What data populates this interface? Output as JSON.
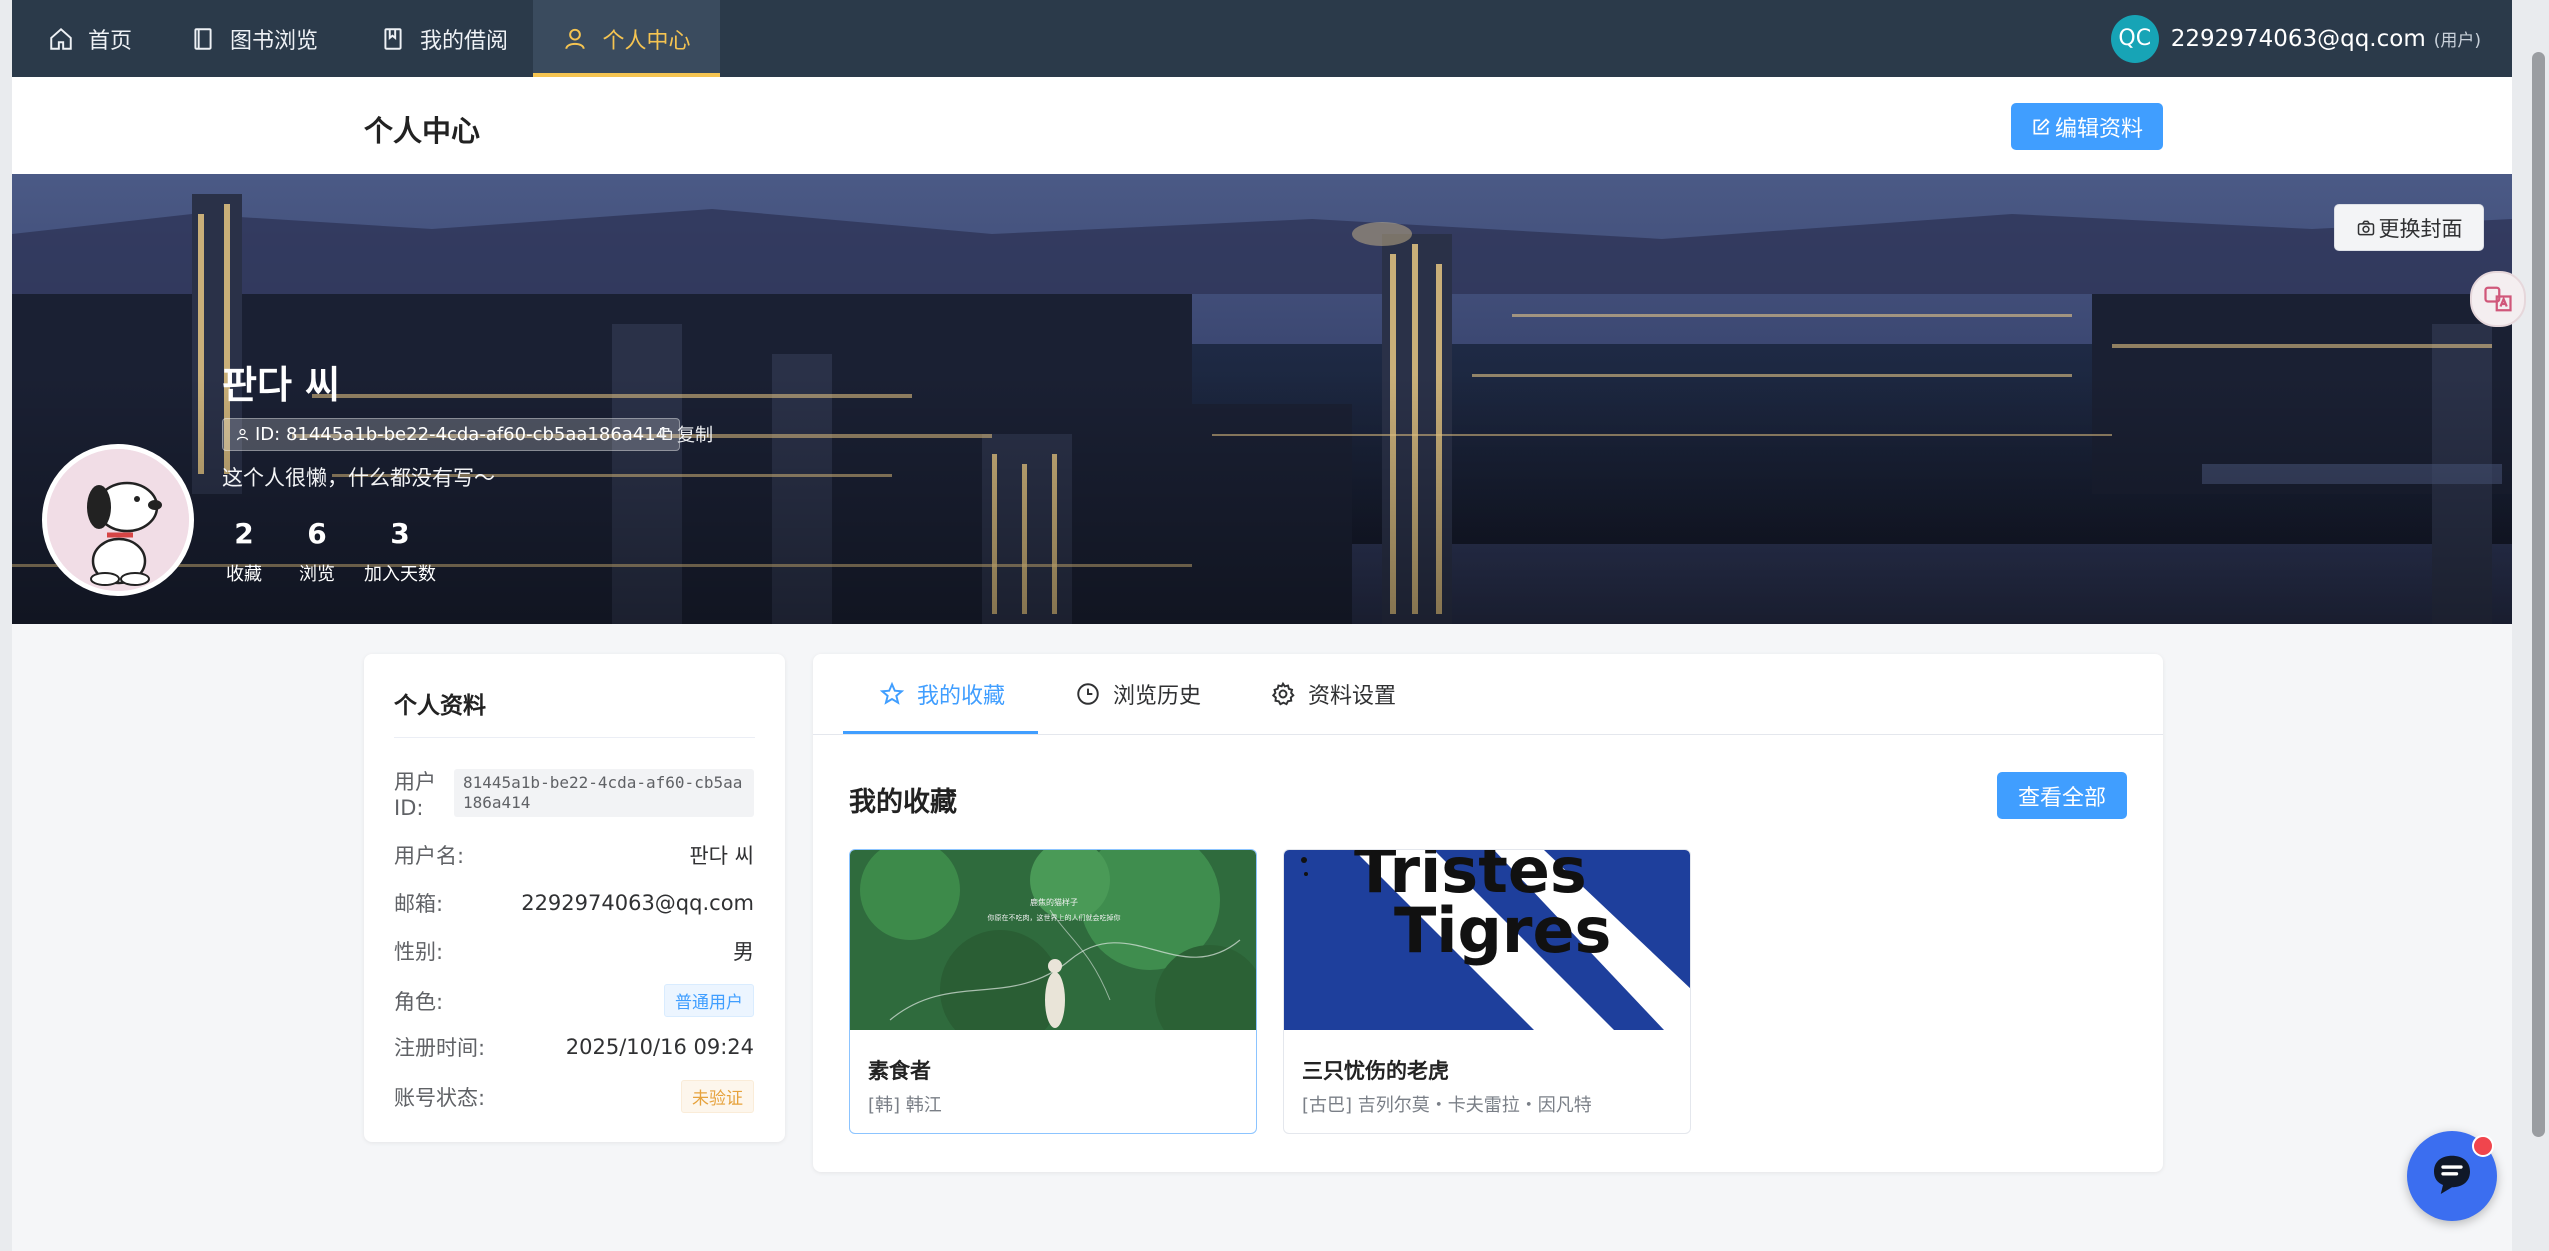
{
  "nav": {
    "items": [
      {
        "label": "首页",
        "icon": "home-icon"
      },
      {
        "label": "图书浏览",
        "icon": "book-icon"
      },
      {
        "label": "我的借阅",
        "icon": "bookmark-icon"
      },
      {
        "label": "个人中心",
        "icon": "user-icon",
        "active": true
      }
    ],
    "user": {
      "initials": "QC",
      "email": "2292974063@qq.com",
      "role": "(用户)"
    }
  },
  "header": {
    "title": "个人中心",
    "edit_button": "编辑资料"
  },
  "cover": {
    "change_cover_button": "更换封面",
    "name": "판다 씨",
    "id_chip": "ID: 81445a1b-be22-4cda-af60-cb5aa186a414",
    "copy_label": "复制",
    "bio": "这个人很懒，什么都没有写～",
    "stats": [
      {
        "value": "2",
        "label": "收藏"
      },
      {
        "value": "6",
        "label": "浏览"
      },
      {
        "value": "3",
        "label": "加入天数"
      }
    ]
  },
  "profile": {
    "title": "个人资料",
    "rows": [
      {
        "label": "用户ID:",
        "value": "81445a1b-be22-4cda-af60-cb5aa186a414"
      },
      {
        "label": "用户名:",
        "value": "판다 씨"
      },
      {
        "label": "邮箱:",
        "value": "2292974063@qq.com"
      },
      {
        "label": "性别:",
        "value": "男"
      },
      {
        "label": "角色:",
        "value": "普通用户"
      },
      {
        "label": "注册时间:",
        "value": "2025/10/16 09:24"
      },
      {
        "label": "账号状态:",
        "value": "未验证"
      }
    ]
  },
  "tabs": [
    {
      "label": "我的收藏",
      "icon": "star-icon",
      "active": true
    },
    {
      "label": "浏览历史",
      "icon": "clock-icon"
    },
    {
      "label": "资料设置",
      "icon": "gear-icon"
    }
  ],
  "favorites": {
    "title": "我的收藏",
    "view_all": "查看全部",
    "books": [
      {
        "title": "素食者",
        "author": "[韩] 韩江",
        "cover_lines": [
          "鹿焦的猫样子",
          "你原在不吃肉，这世界上的人们就会吃掉你"
        ]
      },
      {
        "title": "三只忧伤的老虎",
        "author": "[古巴] 吉列尔莫・卡夫雷拉・因凡特",
        "cover_lines": [
          "Tristes",
          "Tigres"
        ]
      }
    ]
  },
  "colors": {
    "nav_bg": "#2b3a4a",
    "nav_active": "#f5c451",
    "primary": "#409eff",
    "warning": "#e6a23c"
  }
}
